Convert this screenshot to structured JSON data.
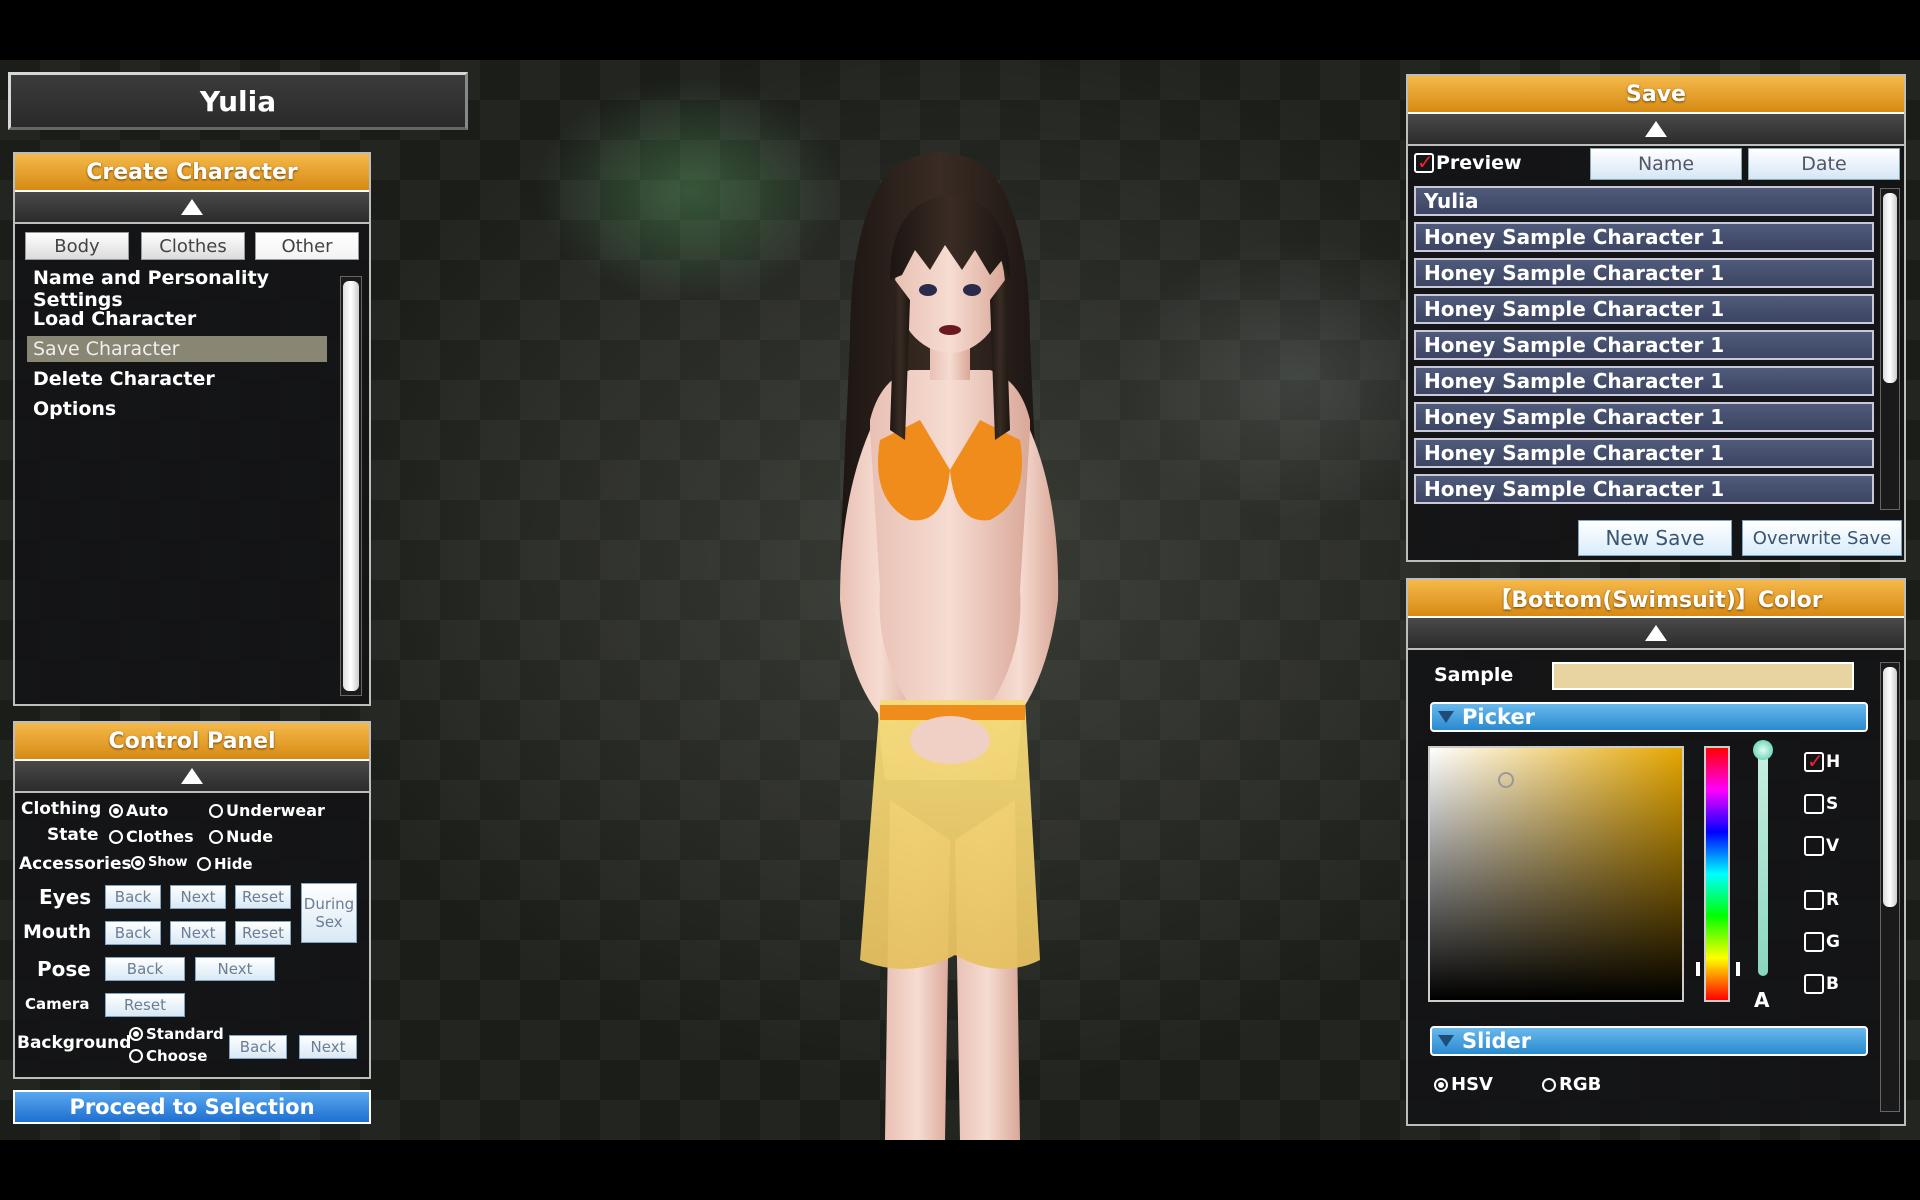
{
  "character_name": "Yulia",
  "create_panel": {
    "title": "Create Character",
    "tabs": [
      "Body",
      "Clothes",
      "Other"
    ],
    "active_tab": "Other",
    "menu": [
      "Name and Personality Settings",
      "Load Character",
      "Save Character",
      "Delete Character",
      "Options"
    ],
    "selected_menu": "Save Character"
  },
  "control_panel": {
    "title": "Control Panel",
    "clothing_label": "Clothing",
    "state_label": "State",
    "clothing_options": [
      "Auto",
      "Underwear",
      "Clothes",
      "Nude"
    ],
    "accessories_label": "Accessories",
    "accessories_options": [
      "Show",
      "Hide"
    ],
    "eyes_label": "Eyes",
    "mouth_label": "Mouth",
    "pose_label": "Pose",
    "camera_label": "Camera",
    "background_label": "Background",
    "background_options": [
      "Standard",
      "Choose"
    ],
    "back": "Back",
    "next": "Next",
    "reset": "Reset",
    "during_sex_1": "During",
    "during_sex_2": "Sex"
  },
  "proceed_button": "Proceed to Selection",
  "save_panel": {
    "title": "Save",
    "preview_label": "Preview",
    "preview_checked": true,
    "sort_name": "Name",
    "sort_date": "Date",
    "entries": [
      "Yulia",
      "Honey Sample Character 1",
      "Honey Sample Character 1",
      "Honey Sample Character 1",
      "Honey Sample Character 1",
      "Honey Sample Character 1",
      "Honey Sample Character 1",
      "Honey Sample Character 1",
      "Honey Sample Character 1"
    ],
    "new_save": "New Save",
    "overwrite_save": "Overwrite Save"
  },
  "color_panel": {
    "title": "【Bottom(Swimsuit)】Color",
    "sample_label": "Sample",
    "sample_color": "#e8d4a0",
    "picker_label": "Picker",
    "alpha_label": "A",
    "channels": [
      {
        "label": "H",
        "checked": true
      },
      {
        "label": "S",
        "checked": false
      },
      {
        "label": "V",
        "checked": false
      },
      {
        "label": "R",
        "checked": false
      },
      {
        "label": "G",
        "checked": false
      },
      {
        "label": "B",
        "checked": false
      }
    ],
    "slider_label": "Slider",
    "mode_options": [
      "HSV",
      "RGB"
    ],
    "mode_selected": "HSV"
  },
  "colors": {
    "accent_orange": "#e39a24",
    "accent_blue": "#2a8ad0",
    "bikini": "#f08c1c",
    "skirt": "#f2d776"
  }
}
